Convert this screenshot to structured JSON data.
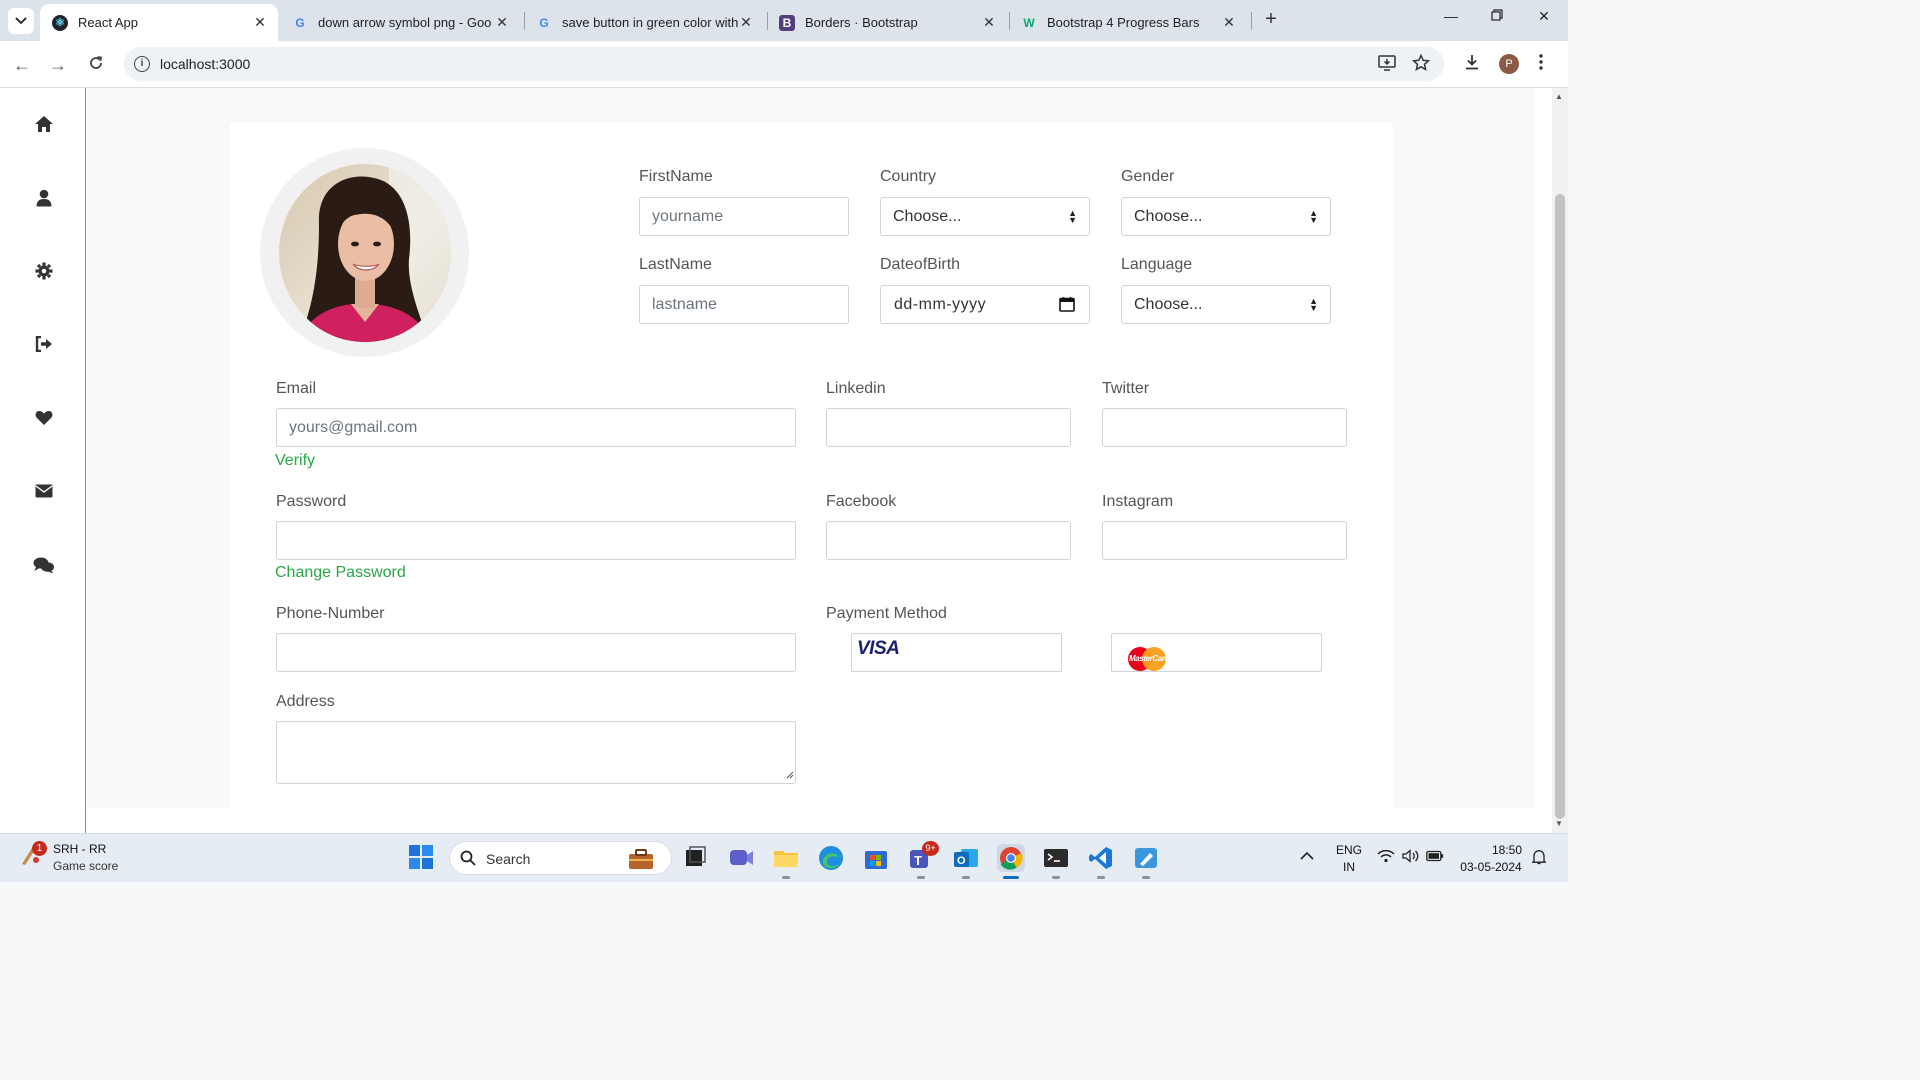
{
  "browser": {
    "tabs": [
      {
        "title": "React App",
        "active": true
      },
      {
        "title": "down arrow symbol png - Goo",
        "active": false
      },
      {
        "title": "save button in green color with",
        "active": false
      },
      {
        "title": "Borders · Bootstrap",
        "active": false
      },
      {
        "title": "Bootstrap 4 Progress Bars",
        "active": false
      }
    ],
    "url": "localhost:3000",
    "profile_initial": "P"
  },
  "sidebar": {
    "items": [
      {
        "icon": "home-icon"
      },
      {
        "icon": "user-icon"
      },
      {
        "icon": "gear-icon"
      },
      {
        "icon": "sign-out-icon"
      },
      {
        "icon": "heart-icon"
      },
      {
        "icon": "envelope-icon"
      },
      {
        "icon": "comments-icon"
      }
    ]
  },
  "form": {
    "firstname": {
      "label": "FirstName",
      "placeholder": "yourname"
    },
    "lastname": {
      "label": "LastName",
      "placeholder": "lastname"
    },
    "country": {
      "label": "Country",
      "value": "Choose..."
    },
    "dob": {
      "label": "DateofBirth",
      "placeholder": "dd-mm-yyyy"
    },
    "gender": {
      "label": "Gender",
      "value": "Choose..."
    },
    "language": {
      "label": "Language",
      "value": "Choose..."
    },
    "email": {
      "label": "Email",
      "placeholder": "yours@gmail.com",
      "action": "Verify"
    },
    "password": {
      "label": "Password",
      "action": "Change Password"
    },
    "phone": {
      "label": "Phone-Number"
    },
    "address": {
      "label": "Address"
    },
    "linkedin": {
      "label": "Linkedin"
    },
    "twitter": {
      "label": "Twitter"
    },
    "facebook": {
      "label": "Facebook"
    },
    "instagram": {
      "label": "Instagram"
    },
    "payment": {
      "label": "Payment Method",
      "visa": "VISA",
      "mastercard": "MasterCard"
    },
    "link_color": "#28a745"
  },
  "taskbar": {
    "weather_title": "SRH - RR",
    "weather_sub": "Game score",
    "weather_badge": "1",
    "search_label": "Search",
    "teams_badge": "9+",
    "lang_top": "ENG",
    "lang_bottom": "IN",
    "time": "18:50",
    "date": "03-05-2024"
  }
}
